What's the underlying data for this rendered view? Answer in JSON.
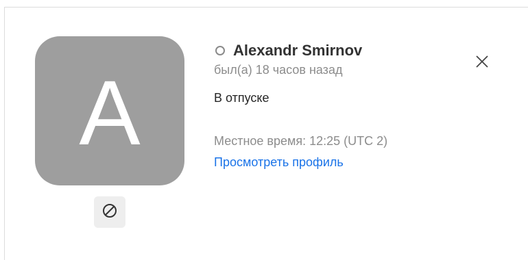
{
  "profile_card": {
    "avatar_letter": "A",
    "name": "Alexandr Smirnov",
    "last_seen": "был(а) 18 часов назад",
    "status": "В отпуске",
    "local_time": "Местное время: 12:25 (UTC 2)",
    "view_profile_link": "Просмотреть профиль",
    "presence": "offline",
    "colors": {
      "avatar_bg": "#9e9e9e",
      "link": "#1a73e8",
      "muted_text": "#8c8c8c",
      "primary_text": "#333333"
    },
    "icons": {
      "presence": "presence-ring-icon",
      "block": "block-icon",
      "close": "close-icon"
    }
  }
}
